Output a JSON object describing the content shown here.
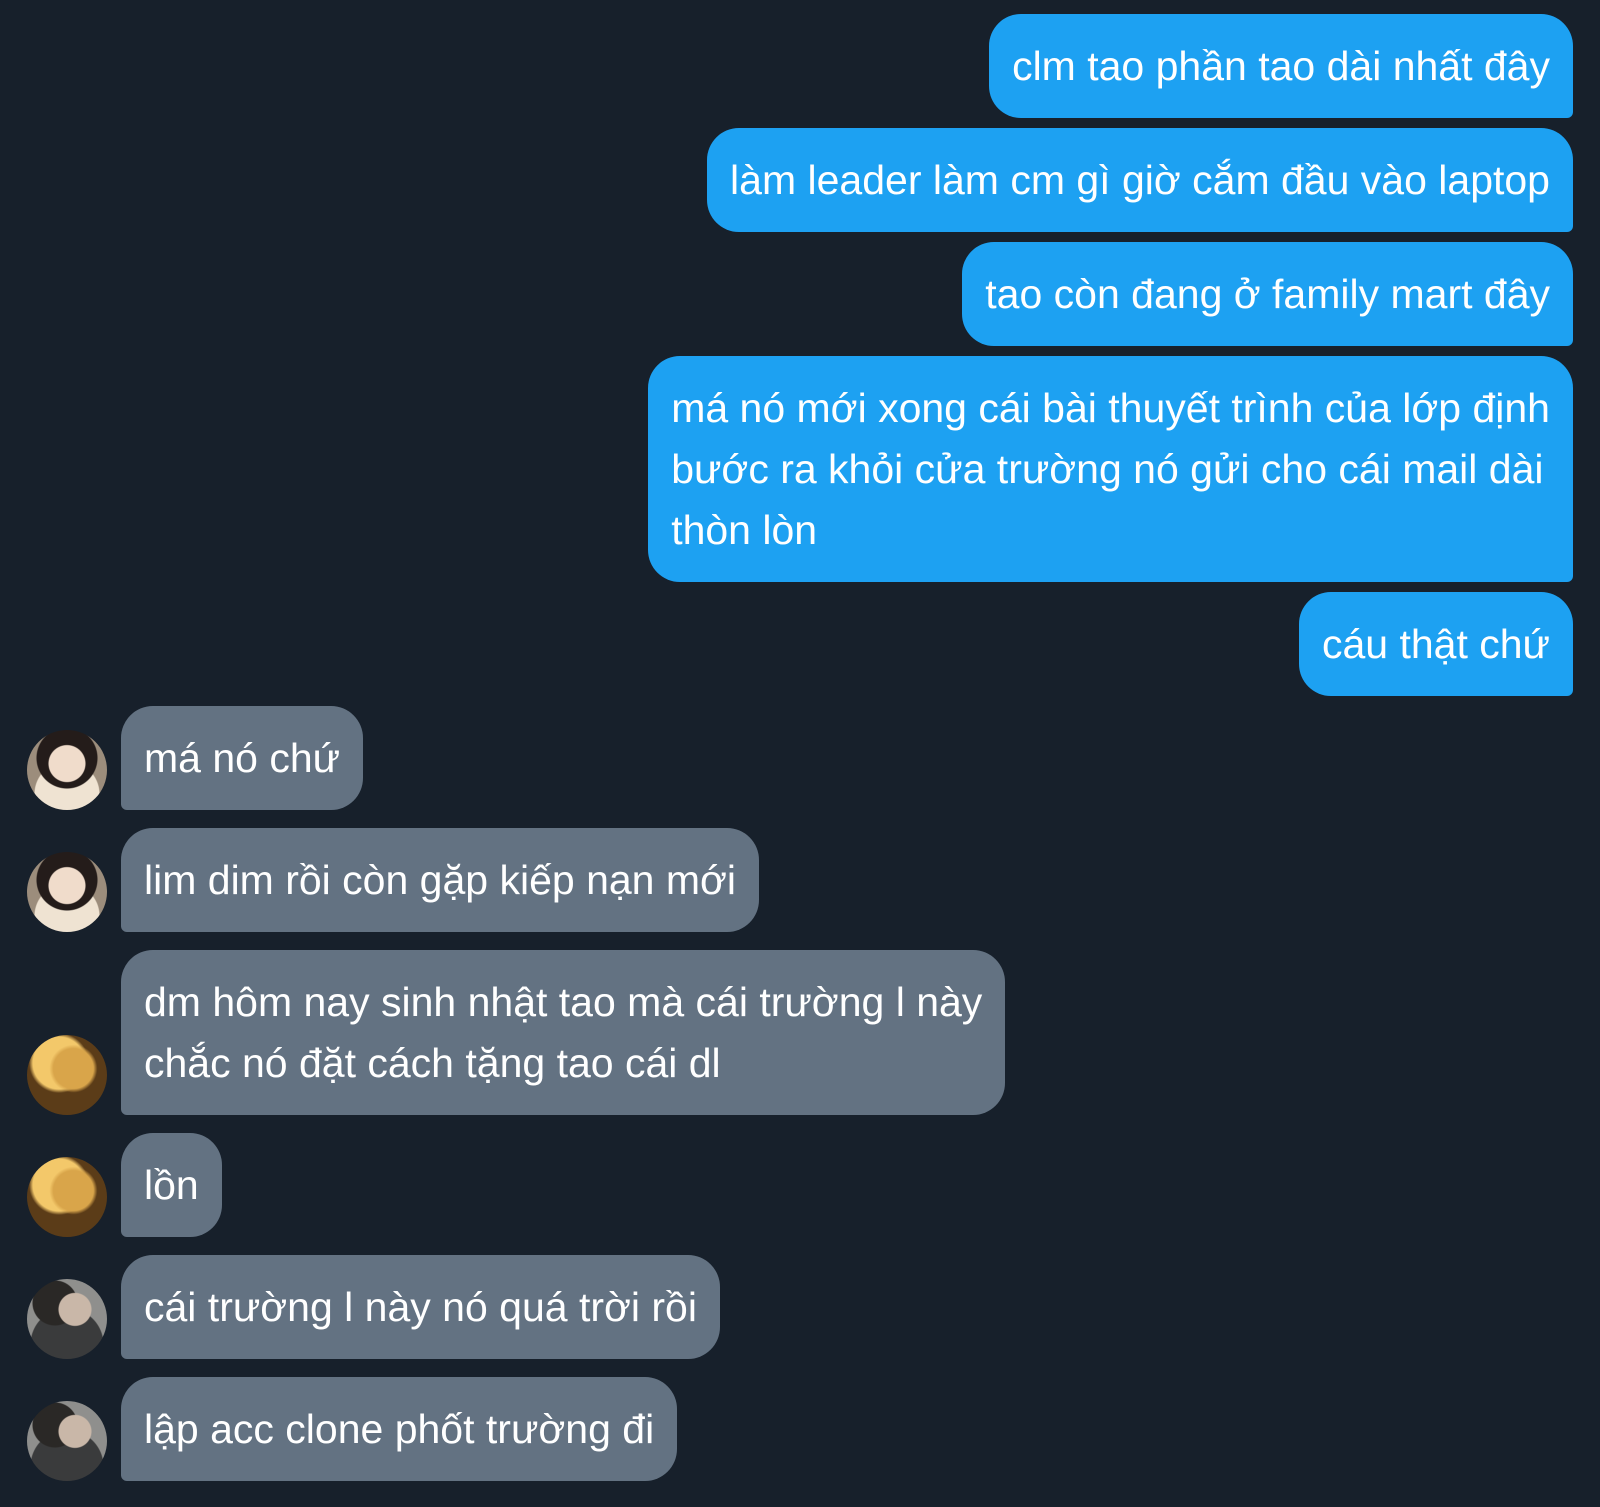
{
  "theme": {
    "background": "#17202b",
    "outgoing_bubble": "#1da1f2",
    "incoming_bubble": "#637282"
  },
  "messages": {
    "out": [
      {
        "text": "clm tao phần tao dài nhất đây"
      },
      {
        "text": "làm leader làm cm gì giờ cắm đầu vào laptop"
      },
      {
        "text": "tao còn đang ở family mart đây"
      },
      {
        "text": "má nó mới xong cái bài thuyết trình của lớp định\nbước ra khỏi cửa trường nó gửi cho cái mail dài\nthòn lòn"
      },
      {
        "text": "cáu thật chứ"
      }
    ],
    "in": [
      {
        "text": "má nó chứ",
        "avatar": "avatar-girl-icon"
      },
      {
        "text": "lim dim rồi còn gặp kiếp nạn mới",
        "avatar": "avatar-girl-icon"
      },
      {
        "text": "dm hôm nay sinh nhật tao mà cái trường l này\nchắc nó đặt cách tặng tao cái dl",
        "avatar": "avatar-blond-icon"
      },
      {
        "text": "lồn",
        "avatar": "avatar-blond-icon"
      },
      {
        "text": "cái trường l này nó quá trời rồi",
        "avatar": "avatar-boy-icon"
      },
      {
        "text": "lập acc clone phốt trường đi",
        "avatar": "avatar-boy-icon"
      }
    ]
  }
}
